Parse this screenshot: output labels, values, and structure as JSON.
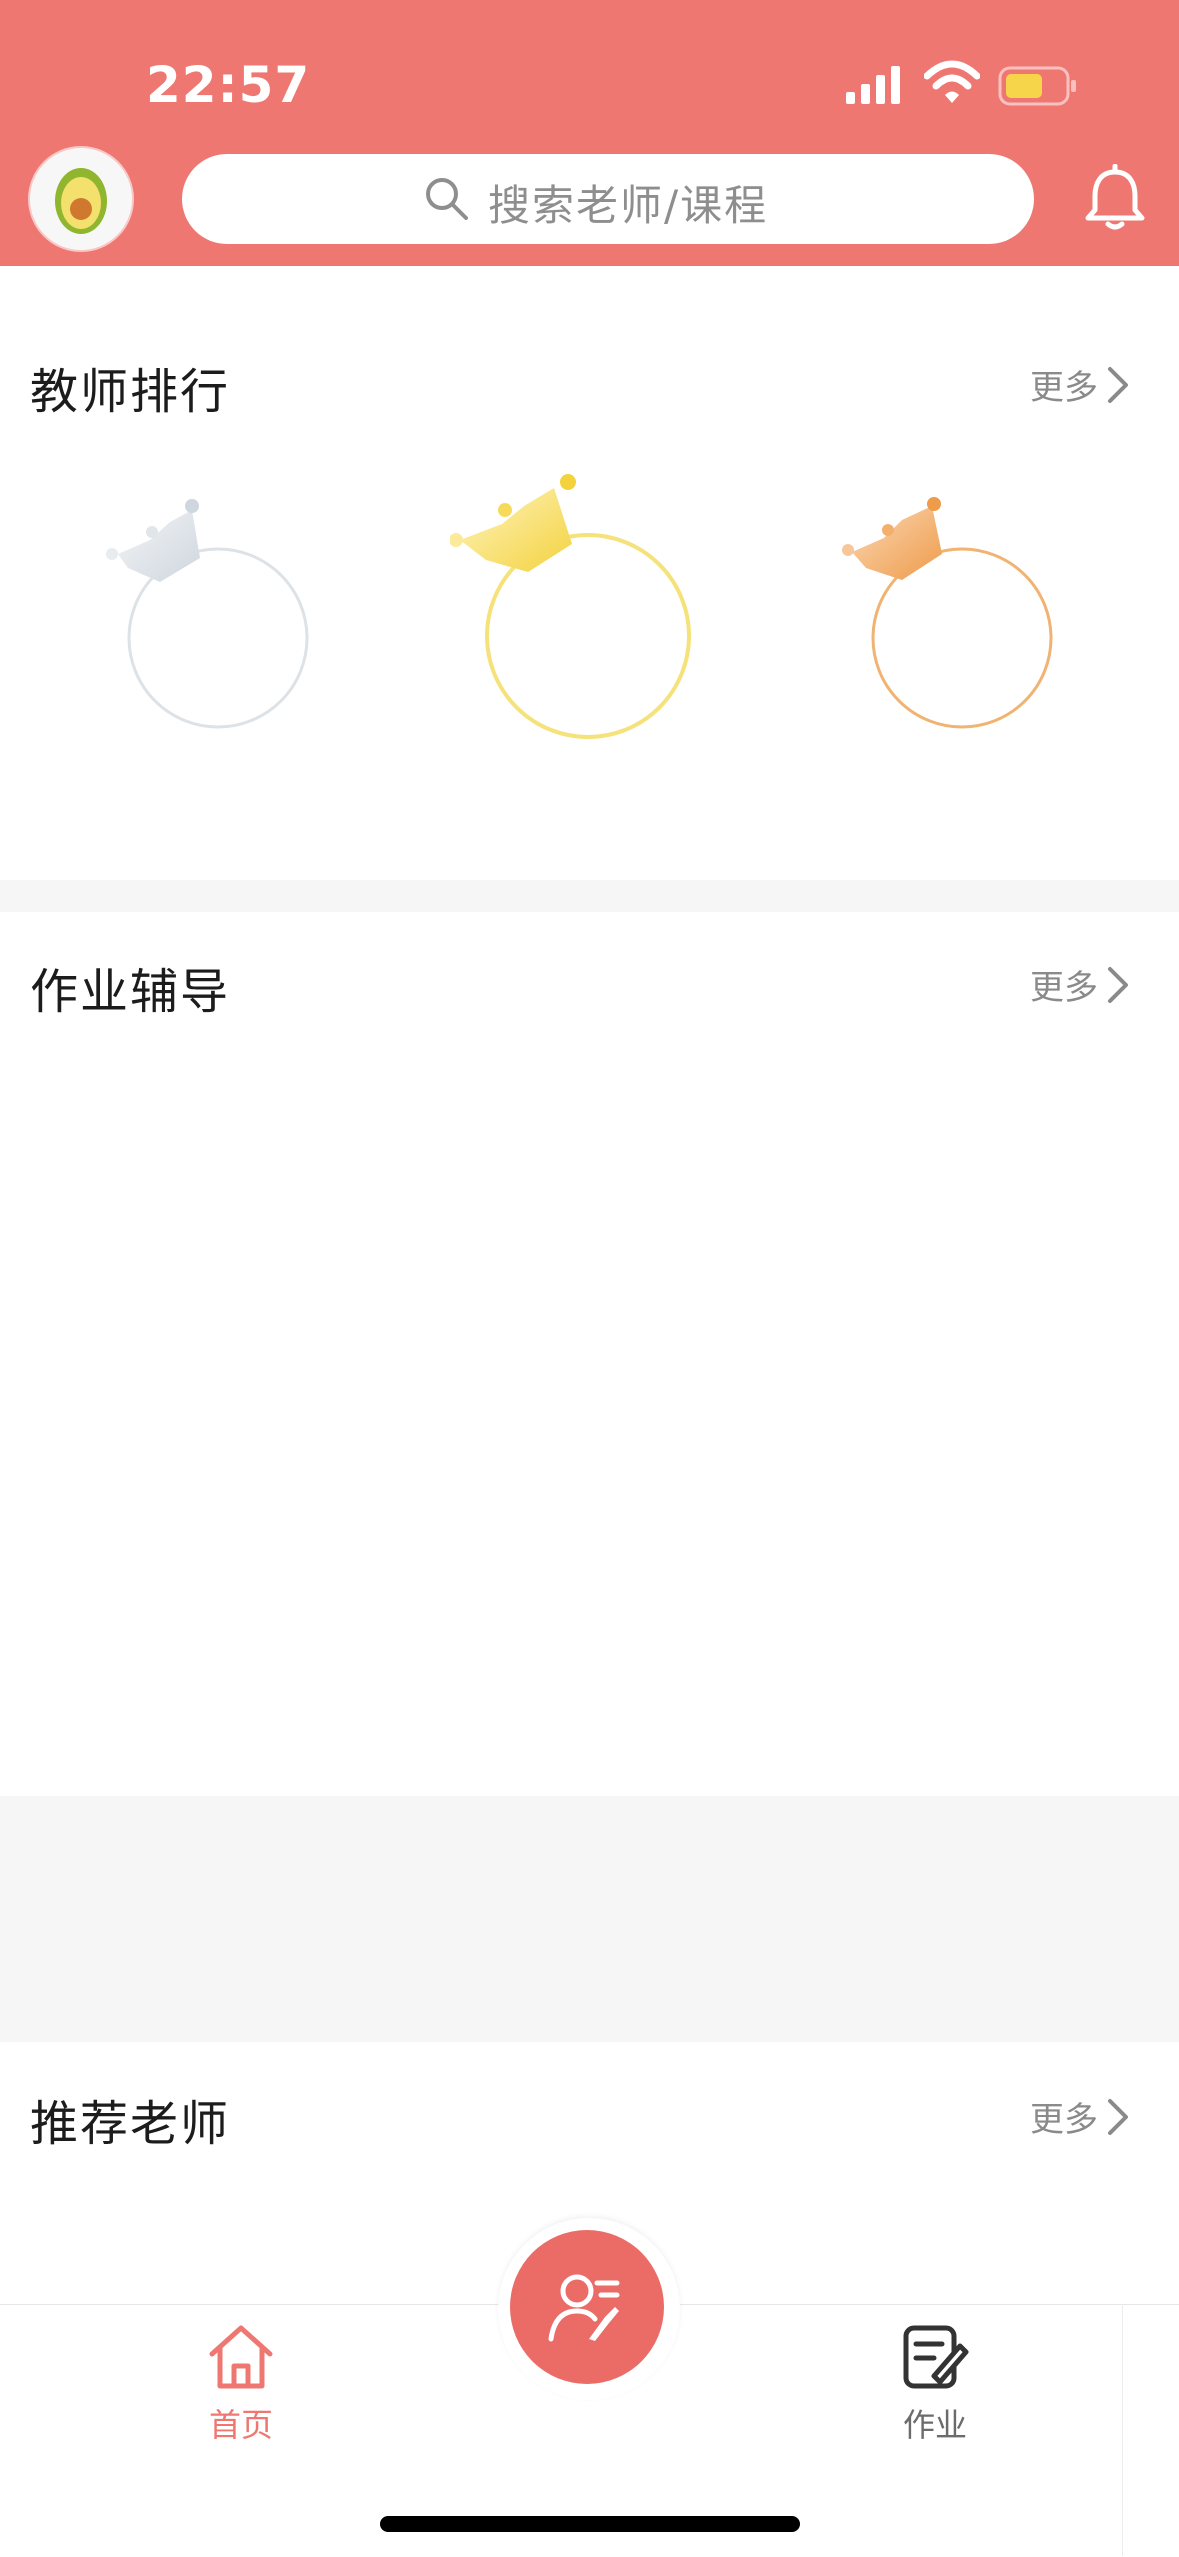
{
  "status_bar": {
    "time": "22:57"
  },
  "header": {
    "search_placeholder": "搜索老师/课程"
  },
  "sections": {
    "teacher_ranking": {
      "title": "教师排行",
      "more": "更多"
    },
    "homework_help": {
      "title": "作业辅导",
      "more": "更多"
    },
    "recommended_teachers": {
      "title": "推荐老师",
      "more": "更多"
    }
  },
  "tabbar": {
    "home": "首页",
    "homework": "作业"
  },
  "colors": {
    "brand": "#EF7772",
    "fab": "#EB6B67",
    "active_tab": "#EF7772",
    "inactive_tab": "#6b6b6b",
    "silver": "#D9DEE3",
    "gold": "#F6D75A",
    "bronze": "#F1A85A"
  },
  "icons": [
    "avatar-avocado-icon",
    "search-icon",
    "bell-icon",
    "chevron-right-icon",
    "crown-icon",
    "home-icon",
    "teacher-icon",
    "edit-note-icon"
  ]
}
